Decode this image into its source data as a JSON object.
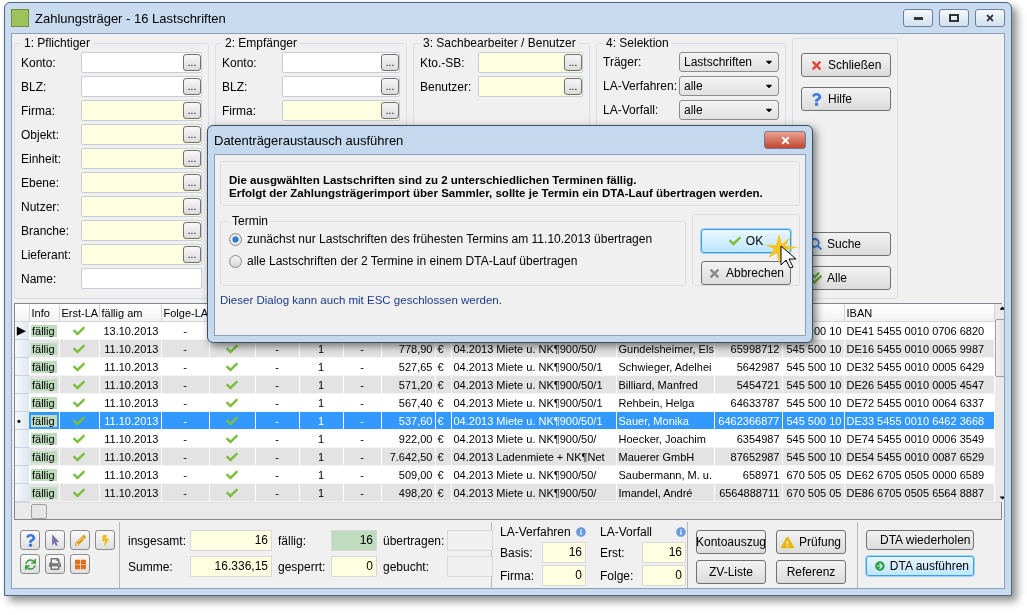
{
  "window": {
    "title": "Zahlungsträger - 16 Lastschriften"
  },
  "groups": [
    {
      "title": "1: Pflichtiger",
      "fields": [
        {
          "label": "Konto:",
          "tinted": false,
          "button": "..."
        },
        {
          "label": "BLZ:",
          "tinted": false,
          "button": "..."
        },
        {
          "label": "Firma:",
          "tinted": true,
          "button": "..."
        },
        {
          "label": "Objekt:",
          "tinted": true,
          "button": "..."
        },
        {
          "label": "Einheit:",
          "tinted": true,
          "button": "..."
        },
        {
          "label": "Ebene:",
          "tinted": true,
          "button": "..."
        },
        {
          "label": "Nutzer:",
          "tinted": true,
          "button": "..."
        },
        {
          "label": "Branche:",
          "tinted": true,
          "button": "..."
        },
        {
          "label": "Lieferant:",
          "tinted": true,
          "button": "..."
        },
        {
          "label": "Name:",
          "tinted": false
        }
      ]
    },
    {
      "title": "2: Empfänger",
      "fields": [
        {
          "label": "Konto:",
          "tinted": false,
          "button": "..."
        },
        {
          "label": "BLZ:",
          "tinted": false,
          "button": "..."
        },
        {
          "label": "Firma:",
          "tinted": true,
          "button": "..."
        }
      ]
    },
    {
      "title": "3: Sachbearbeiter / Benutzer",
      "fields": [
        {
          "label": "Kto.-SB:",
          "tinted": true,
          "button": "..."
        },
        {
          "label": "Benutzer:",
          "tinted": true,
          "button": "..."
        }
      ]
    }
  ],
  "selektion": {
    "title": "4: Selektion",
    "dropdowns": [
      {
        "label": "Träger:",
        "value": "Lastschriften"
      },
      {
        "label": "LA-Verfahren:",
        "value": "alle"
      },
      {
        "label": "LA-Vorfall:",
        "value": "alle"
      }
    ]
  },
  "actions": {
    "top": [
      {
        "label": "Schließen",
        "kind": "close"
      },
      {
        "label": "Hilfe",
        "kind": "help"
      }
    ],
    "bottom": [
      {
        "label": "Suche",
        "kind": "search"
      },
      {
        "label": "Alle",
        "kind": "all"
      }
    ]
  },
  "table": {
    "columns": [
      "Info",
      "Erst-LA",
      "fällig am",
      "Folge-LA",
      null,
      null,
      null,
      null,
      null,
      null,
      null,
      null,
      null,
      null,
      "IBAN"
    ],
    "rows": [
      {
        "indicator": "▶",
        "selected": false,
        "cells": [
          "fällig",
          true,
          "13.10.2013",
          "-",
          null,
          null,
          null,
          null,
          null,
          null,
          null,
          null,
          null,
          "00 10",
          "DE41 5455 0010 0706 6820"
        ]
      },
      {
        "selected": false,
        "cells": [
          "fällig",
          true,
          "11.10.2013",
          "-",
          true,
          "-",
          "1",
          "-",
          "778,90",
          "€",
          "04.2013 Miete u. NK¶900/50/",
          "Gundelsheimer, Els",
          "65998712",
          "545 500 10",
          "DE16 5455 0010 0065 9987"
        ]
      },
      {
        "selected": false,
        "cells": [
          "fällig",
          true,
          "11.10.2013",
          "-",
          true,
          "-",
          "1",
          "-",
          "527,65",
          "€",
          "04.2013 Miete u. NK¶900/50/1",
          "Schwieger, Adelhei",
          "5642987",
          "545 500 10",
          "DE32 5455 0010 0005 6429"
        ]
      },
      {
        "selected": false,
        "cells": [
          "fällig",
          true,
          "11.10.2013",
          "-",
          true,
          "-",
          "1",
          "-",
          "571,20",
          "€",
          "04.2013 Miete u. NK¶900/50/1",
          "Billiard, Manfred",
          "5454721",
          "545 500 10",
          "DE26 5455 0010 0005 4547"
        ]
      },
      {
        "selected": false,
        "cells": [
          "fällig",
          true,
          "11.10.2013",
          "-",
          true,
          "-",
          "1",
          "-",
          "567,40",
          "€",
          "04.2013 Miete u. NK¶900/50/1",
          "Rehbein, Helga",
          "64633787",
          "545 500 10",
          "DE72 5455 0010 0064 6337"
        ]
      },
      {
        "indicator": "•",
        "selected": true,
        "cells": [
          "fällig",
          true,
          "11.10.2013",
          "-",
          true,
          "-",
          "1",
          "-",
          "537,60",
          "€",
          "04.2013 Miete u. NK¶900/50/1",
          "Sauer, Monika",
          "6462366877",
          "545 500 10",
          "DE33 5455 0010 6462 3668"
        ]
      },
      {
        "selected": false,
        "cells": [
          "fällig",
          true,
          "11.10.2013",
          "-",
          true,
          "-",
          "1",
          "-",
          "922,00",
          "€",
          "04.2013 Miete u. NK¶900/50/",
          "Hoecker, Joachim",
          "6354987",
          "545 500 10",
          "DE74 5455 0010 0006 3549"
        ]
      },
      {
        "selected": false,
        "cells": [
          "fällig",
          true,
          "11.10.2013",
          "-",
          true,
          "-",
          "1",
          "-",
          "7.642,50",
          "€",
          "04.2013 Ladenmiete + NK¶Net",
          "Mauerer GmbH",
          "87652987",
          "545 500 10",
          "DE54 5455 0010 0087 6529"
        ]
      },
      {
        "selected": false,
        "cells": [
          "fällig",
          true,
          "11.10.2013",
          "-",
          true,
          "-",
          "1",
          "-",
          "509,00",
          "€",
          "04.2013 Miete u. NK¶900/50/",
          "Saubermann, M. u.",
          "658971",
          "670 505 05",
          "DE62 6705 0505 0000 6589"
        ]
      },
      {
        "selected": false,
        "cells": [
          "fällig",
          true,
          "11.10.2013",
          "-",
          true,
          "-",
          "1",
          "-",
          "498,20",
          "€",
          "04.2013 Miete u. NK¶900/50/",
          "Imandel, André",
          "6564888711",
          "670 505 05",
          "DE86 6705 0505 6564 8887"
        ]
      }
    ]
  },
  "toolbar": [
    {
      "kind": "help"
    },
    {
      "kind": "pointer"
    },
    {
      "kind": "pencil"
    },
    {
      "kind": "bolt"
    },
    {
      "kind": "refresh"
    },
    {
      "kind": "printer"
    },
    {
      "kind": "layout"
    }
  ],
  "totals": [
    {
      "label": "insgesamt:",
      "value": "16",
      "kind": "input"
    },
    {
      "label": "fällig:",
      "value": "16",
      "kind": "due"
    },
    {
      "label": "übertragen:",
      "kind": "empty"
    },
    {
      "label": "Summe:",
      "value": "16.336,15",
      "kind": "input"
    },
    {
      "label": "gesperrt:",
      "value": "0",
      "kind": "input"
    },
    {
      "label": "gebucht:",
      "kind": "empty"
    }
  ],
  "counters": [
    {
      "title": "LA-Verfahren",
      "fields": [
        {
          "label": "Basis:",
          "value": "16"
        },
        {
          "label": "Firma:",
          "value": "0"
        }
      ]
    },
    {
      "title": "LA-Vorfall",
      "fields": [
        {
          "label": "Erst:",
          "value": "16"
        },
        {
          "label": "Folge:",
          "value": "0"
        }
      ]
    }
  ],
  "reports": [
    {
      "label": "Kontoauszug"
    },
    {
      "label": "Prüfung",
      "kind": "warning"
    },
    {
      "label": "ZV-Liste"
    },
    {
      "label": "Referenz"
    }
  ],
  "dta": [
    {
      "label": "DTA wiederholen",
      "kind": "repeat",
      "focused": false
    },
    {
      "label": "DTA ausführen",
      "kind": "go",
      "focused": true
    }
  ],
  "dialog": {
    "title": "Datenträgeraustausch ausführen",
    "message": [
      "Die ausgwählten Lastschriften sind zu 2 unterschiedlichen Terminen fällig.",
      "Erfolgt der Zahlungsträgerimport über Sammler, sollte je Termin ein DTA-Lauf übertragen werden."
    ],
    "group": "Termin",
    "options": [
      {
        "label": "zunächst nur Lastschriften des frühesten Termins am 11.10.2013 übertragen",
        "selected": true
      },
      {
        "label": "alle Lastschriften der 2 Termine in einem DTA-Lauf übertragen",
        "selected": false
      }
    ],
    "buttons": [
      {
        "label": "OK",
        "kind": "check",
        "focused": true
      },
      {
        "label": "Abbrechen",
        "kind": "cancel",
        "focused": false
      }
    ],
    "footer": "Dieser Dialog kann auch mit ESC geschlossen werden."
  }
}
